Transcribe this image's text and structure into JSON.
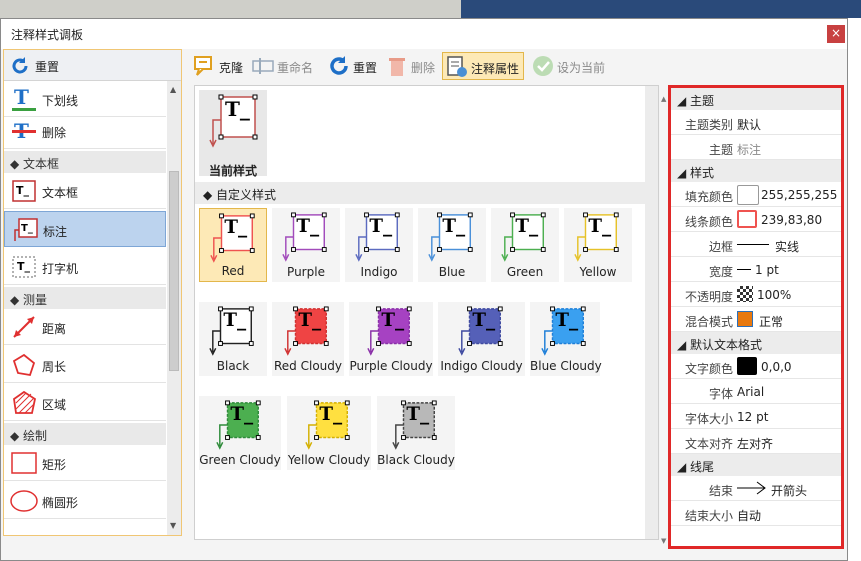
{
  "window": {
    "title": "注释样式调板",
    "close_glyph": "×"
  },
  "left_panel": {
    "reset_label": "重置",
    "items": [
      {
        "label": "下划线",
        "icon": "underline-text-icon",
        "type": "item"
      },
      {
        "label": "删除",
        "icon": "strikeout-text-icon",
        "type": "item"
      },
      {
        "label": "文本框",
        "type": "category"
      },
      {
        "label": "文本框",
        "icon": "textbox-icon",
        "type": "item"
      },
      {
        "label": "标注",
        "icon": "callout-icon",
        "type": "item",
        "selected": true
      },
      {
        "label": "打字机",
        "icon": "typewriter-icon",
        "type": "item"
      },
      {
        "label": "测量",
        "type": "category"
      },
      {
        "label": "距离",
        "icon": "distance-icon",
        "type": "item"
      },
      {
        "label": "周长",
        "icon": "perimeter-icon",
        "type": "item"
      },
      {
        "label": "区域",
        "icon": "area-icon",
        "type": "item"
      },
      {
        "label": "绘制",
        "type": "category"
      },
      {
        "label": "矩形",
        "icon": "rectangle-icon",
        "type": "item"
      },
      {
        "label": "椭圆形",
        "icon": "ellipse-icon",
        "type": "item"
      }
    ]
  },
  "toolbar": {
    "clone": "克隆",
    "rename": "重命名",
    "reset": "重置",
    "delete": "删除",
    "properties": "注释属性",
    "set_current": "设为当前"
  },
  "center": {
    "current_label": "当前样式",
    "custom_header": "自定义样式",
    "styles": [
      {
        "label": "Red",
        "color": "#ef5350",
        "fill": "",
        "selected": true
      },
      {
        "label": "Purple",
        "color": "#a24bbb",
        "fill": ""
      },
      {
        "label": "Indigo",
        "color": "#5c6bc0",
        "fill": ""
      },
      {
        "label": "Blue",
        "color": "#4a90d9",
        "fill": ""
      },
      {
        "label": "Green",
        "color": "#4caf50",
        "fill": ""
      },
      {
        "label": "Yellow",
        "color": "#e6c229",
        "fill": ""
      },
      {
        "label": "Black",
        "color": "#222222",
        "fill": ""
      },
      {
        "label": "Red Cloudy",
        "color": "#d03030",
        "fill": "#ef4444"
      },
      {
        "label": "Purple Cloudy",
        "color": "#8a2fa8",
        "fill": "#a642c2"
      },
      {
        "label": "Indigo Cloudy",
        "color": "#3f4aa0",
        "fill": "#5560b8"
      },
      {
        "label": "Blue Cloudy",
        "color": "#1e7fd8",
        "fill": "#3aa0f0"
      },
      {
        "label": "Green Cloudy",
        "color": "#2e8b3a",
        "fill": "#4caf50"
      },
      {
        "label": "Yellow Cloudy",
        "color": "#d4b000",
        "fill": "#ffe040"
      },
      {
        "label": "Black Cloudy",
        "color": "#444444",
        "fill": "#b8b8b8"
      }
    ]
  },
  "properties": {
    "sections": {
      "theme": "主题",
      "style": "样式",
      "default_text": "默认文本格式",
      "line_end": "线尾"
    },
    "theme_category": {
      "key": "主题类别",
      "value": "默认"
    },
    "theme": {
      "key": "主题",
      "value": "标注"
    },
    "fill_color": {
      "key": "填充颜色",
      "value": "255,255,255",
      "swatch": "#ffffff"
    },
    "line_color": {
      "key": "线条颜色",
      "value": "239,83,80",
      "swatch": "#ef5350"
    },
    "border": {
      "key": "边框",
      "value": "实线"
    },
    "width": {
      "key": "宽度",
      "value": "1 pt"
    },
    "opacity": {
      "key": "不透明度",
      "value": "100%"
    },
    "blend": {
      "key": "混合模式",
      "value": "正常"
    },
    "text_color": {
      "key": "文字颜色",
      "value": "0,0,0",
      "swatch": "#000000"
    },
    "font": {
      "key": "字体",
      "value": "Arial"
    },
    "font_size": {
      "key": "字体大小",
      "value": "12 pt"
    },
    "text_align": {
      "key": "文本对齐",
      "value": "左对齐"
    },
    "end": {
      "key": "结束",
      "value": "开箭头"
    },
    "end_size": {
      "key": "结束大小",
      "value": "自动"
    }
  }
}
